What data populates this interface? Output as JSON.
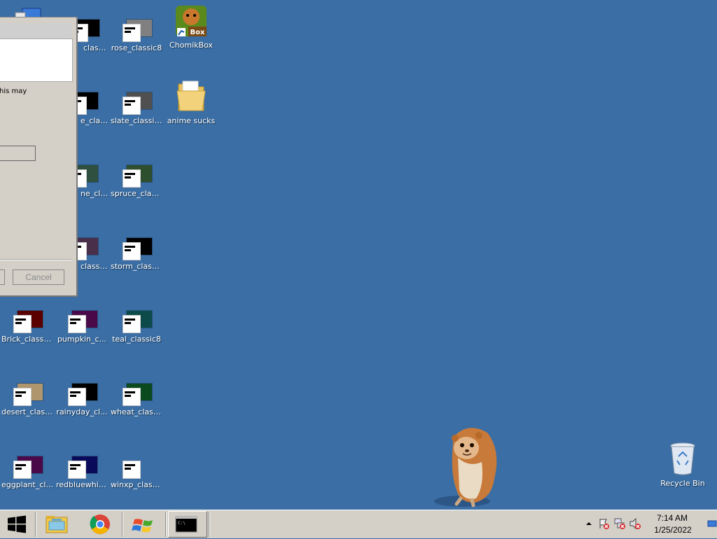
{
  "desktop": {
    "icons": [
      {
        "label": "classic8",
        "swatch": "#000000",
        "type": "theme"
      },
      {
        "label": "rose_classic8",
        "swatch": "#808080",
        "type": "theme"
      },
      {
        "label": "ChomikBox",
        "type": "app"
      },
      {
        "label": "e_class...",
        "swatch": "#000000",
        "type": "theme"
      },
      {
        "label": "slate_classic8",
        "swatch": "#505050",
        "type": "theme"
      },
      {
        "label": "anime sucks",
        "type": "folder"
      },
      {
        "label": "ne_cla...",
        "swatch": "#2f4f3f",
        "type": "theme"
      },
      {
        "label": "spruce_class...",
        "swatch": "#2d4f2d",
        "type": "theme"
      },
      {
        "label": "classic8",
        "swatch": "#4a2f4a",
        "type": "theme"
      },
      {
        "label": "storm_class...",
        "swatch": "#000000",
        "type": "theme"
      },
      {
        "label": "Brick_classic8",
        "swatch": "#5a0000",
        "type": "theme"
      },
      {
        "label": "pumpkin_c...",
        "swatch": "#4a0a4a",
        "type": "theme"
      },
      {
        "label": "teal_classic8",
        "swatch": "#0d4a4a",
        "type": "theme"
      },
      {
        "label": "desert_class...",
        "swatch": "#b0966c",
        "type": "theme"
      },
      {
        "label": "rainyday_cl...",
        "swatch": "#000000",
        "type": "theme"
      },
      {
        "label": "wheat_class...",
        "swatch": "#0a4a1e",
        "type": "theme"
      },
      {
        "label": "eggplant_cl...",
        "swatch": "#4a0a4a",
        "type": "theme"
      },
      {
        "label": "redbluewhit...",
        "swatch": "#0a0a5a",
        "type": "theme"
      },
      {
        "label": "winxp_class...",
        "swatch": "",
        "type": "theme"
      },
      {
        "label": "Recycle Bin",
        "type": "recycle-bin"
      }
    ]
  },
  "dialog": {
    "message_fragment": "his may",
    "cancel_label": "Cancel"
  },
  "taskbar": {
    "pinned": [
      "file-explorer-icon",
      "chrome-icon",
      "windows-icon",
      "cmd-icon"
    ],
    "clock": {
      "time": "7:14 AM",
      "date": "1/25/2022"
    }
  },
  "colors": {
    "desktop": "#3a6ea5",
    "taskbar": "#d4d0c8"
  }
}
